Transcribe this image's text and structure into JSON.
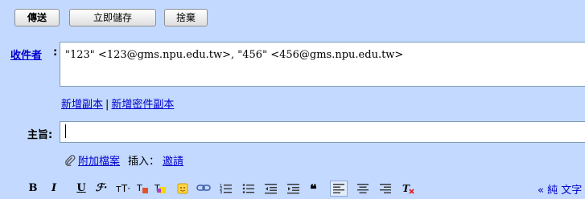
{
  "toolbar_top": {
    "send": "傳送",
    "save_now": "立即儲存",
    "discard": "捨棄"
  },
  "to": {
    "label": "收件者",
    "colon": ":",
    "value": "\"123\" <123@gms.npu.edu.tw>, \"456\" <456@gms.npu.edu.tw>"
  },
  "cc": {
    "add_cc": "新增副本",
    "separator": "|",
    "add_bcc": "新增密件副本"
  },
  "subject": {
    "label": "主旨:",
    "value": ""
  },
  "attach": {
    "attach_file": "附加檔案",
    "insert_label": "插入：",
    "invite": "邀請"
  },
  "format": {
    "bold": "B",
    "italic": "I",
    "underline": "U",
    "font": "ℱ·",
    "size": "тT·",
    "plain_text": "« 純 文字"
  },
  "colors": {
    "background": "#c3d9ff",
    "link": "#0000cc"
  }
}
